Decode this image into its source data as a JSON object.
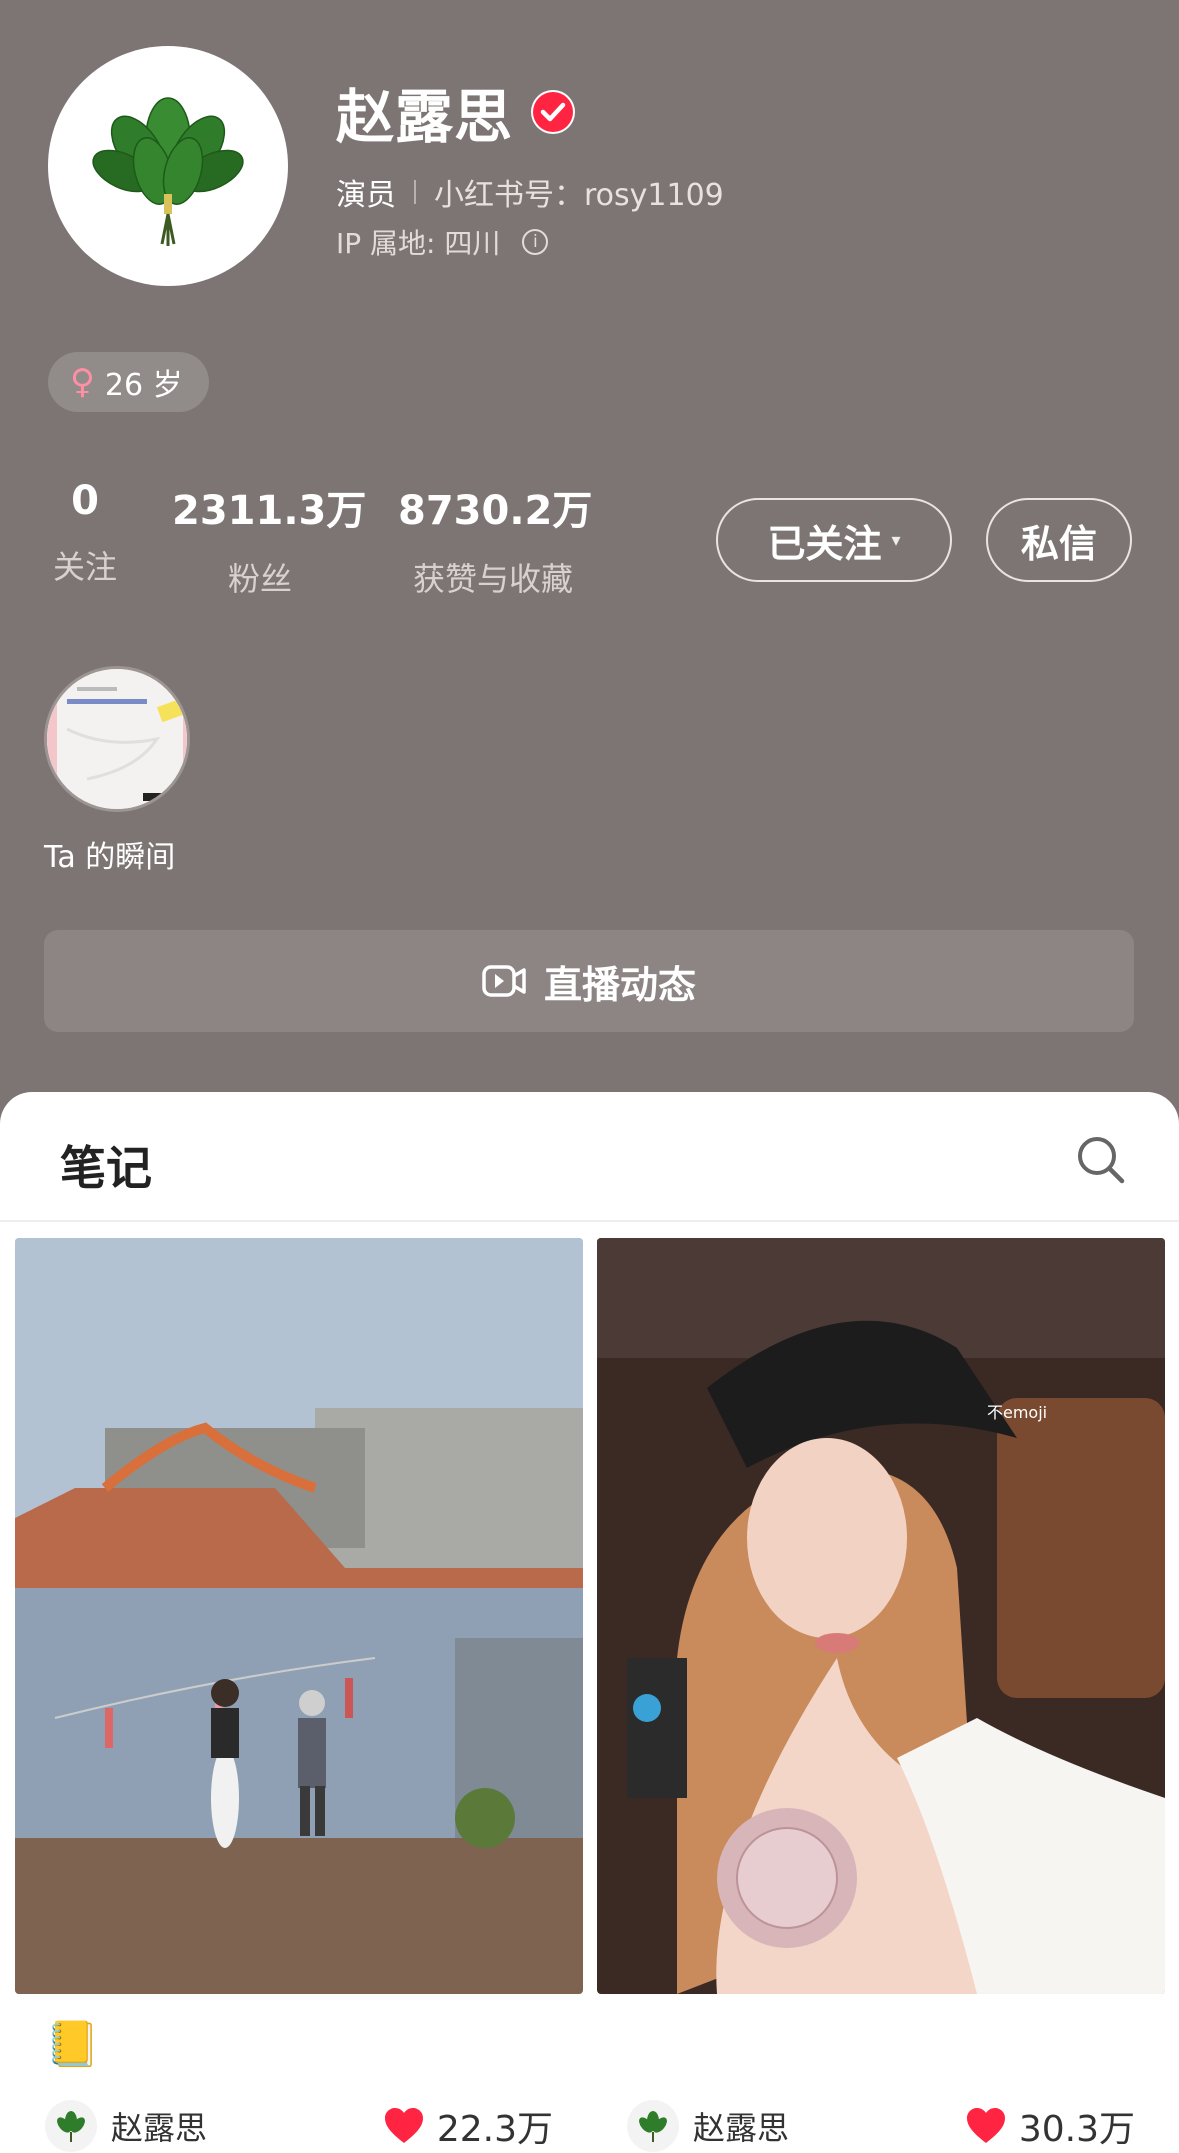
{
  "profile": {
    "name": "赵露思",
    "role": "演员",
    "red_id": "小红书号：rosy1109",
    "ip_location": "IP 属地: 四川",
    "info_glyph": "i",
    "age": "26 岁",
    "female_glyph": "♀"
  },
  "stats": [
    {
      "value": "0",
      "label": "关注"
    },
    {
      "value": "2311.3万",
      "label": "粉丝"
    },
    {
      "value": "8730.2万",
      "label": "获赞与收藏"
    }
  ],
  "actions": {
    "follow_label": "已关注",
    "caret": "▾",
    "message_label": "私信"
  },
  "moments": {
    "label": "Ta 的瞬间"
  },
  "live": {
    "label": "直播动态",
    "icon": "video-camera-icon"
  },
  "tabs": {
    "notes_label": "笔记",
    "search_icon": "search-icon"
  },
  "notes": [
    {
      "emoji": "📒",
      "author": "赵露思",
      "likes": "22.3万"
    },
    {
      "emoji": "🐱",
      "author": "赵露思",
      "likes": "30.3万"
    }
  ],
  "colors": {
    "header_bg": "#7d7574",
    "verified_red": "#ff2442",
    "like_red": "#ff2442"
  }
}
